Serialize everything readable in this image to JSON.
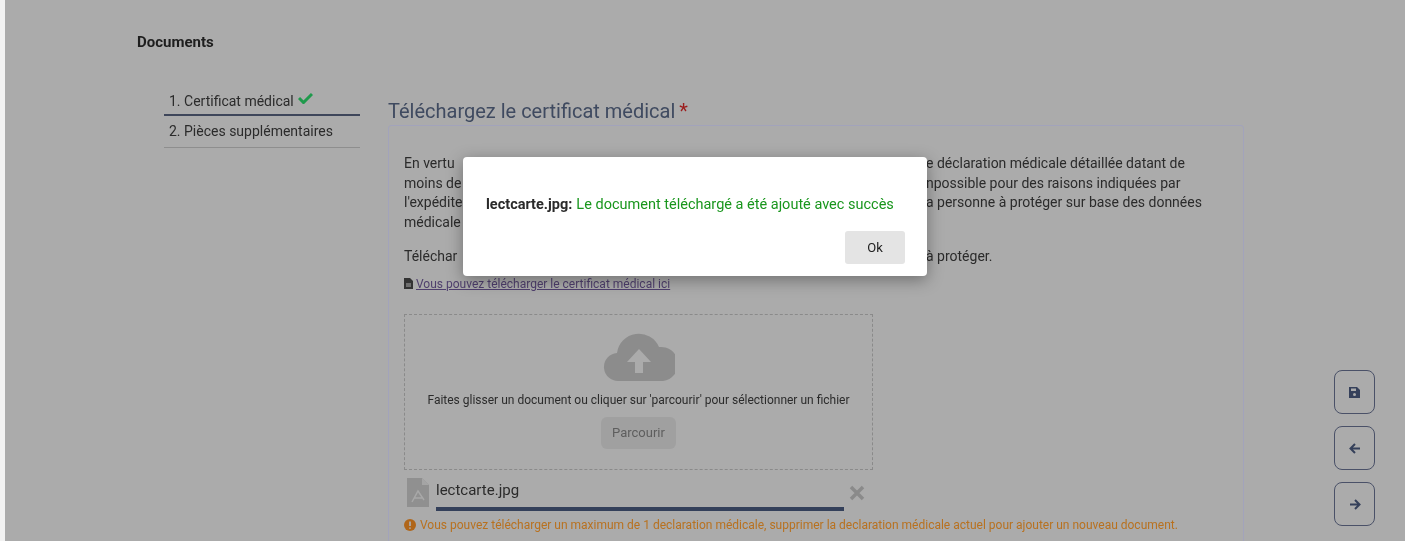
{
  "section_title": "Documents",
  "steps": [
    {
      "label": "1. Certificat médical",
      "selected": true,
      "done": true
    },
    {
      "label": "2. Pièces supplémentaires",
      "selected": false,
      "done": false
    }
  ],
  "heading": "Téléchargez le certificat médical",
  "required_mark": "*",
  "paragraph_lines": [
    {
      "left": "En vertu",
      "right": "e déclaration médicale détaillée datant de"
    },
    {
      "left": "moins de",
      "right": "npossible pour des raisons indiquées par"
    },
    {
      "left": "l'expédite",
      "right": "a personne à protéger sur base des données"
    },
    {
      "left": "médicale"
    }
  ],
  "paragraph2": {
    "left": "Téléchar",
    "right": "à protéger."
  },
  "download_link": "Vous pouvez télécharger le certificat médical ici",
  "dropzone": {
    "hint": "Faites glisser un document ou cliquer sur 'parcourir' pour sélectionner un fichier",
    "button": "Parcourir"
  },
  "file": {
    "name": "lectcarte.jpg",
    "level": 1
  },
  "warning": "Vous pouvez télécharger un maximum de 1 declaration médicale, supprimer la declaration médicale actuel pour ajouter un nouveau document.",
  "side_buttons": [
    {
      "kind": "save"
    },
    {
      "kind": "back"
    },
    {
      "kind": "next"
    }
  ],
  "dialog": {
    "filename": "lectcarte.jpg:",
    "message": "Le document téléchargé a été ajouté avec succès",
    "button": "Ok"
  }
}
